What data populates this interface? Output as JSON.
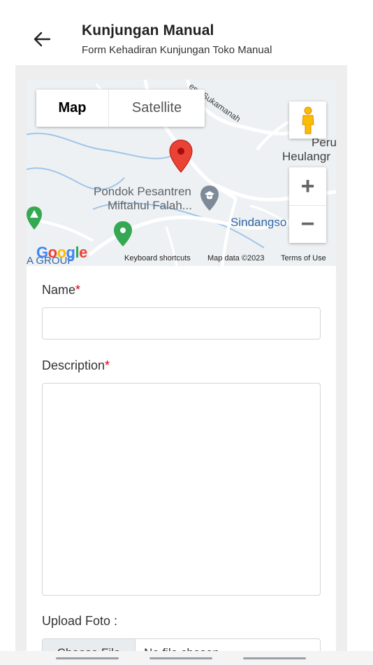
{
  "header": {
    "title": "Kunjungan Manual",
    "subtitle": "Form Kehadiran Kunjungan Toko Manual"
  },
  "map": {
    "type_map": "Map",
    "type_satellite": "Satellite",
    "zoom_in": "+",
    "zoom_out": "−",
    "places": {
      "road": "esa Sukamanah",
      "peru": "Peru",
      "heulang": "Heulangr",
      "pondok_line1": "Pondok Pesantren",
      "pondok_line2": "Miftahul Falah...",
      "sindang": "Sindangso",
      "agroup": "A GROUP"
    },
    "logo": "Google",
    "attribution": {
      "shortcuts": "Keyboard shortcuts",
      "data": "Map data ©2023",
      "terms": "Terms of Use"
    }
  },
  "form": {
    "name_label": "Name",
    "description_label": "Description",
    "required_mark": "*",
    "upload_label": "Upload Foto :",
    "name_value": "",
    "description_value": "",
    "choose_file": "Choose File",
    "no_file": "No file chosen"
  },
  "colors": {
    "required": "#d0021b",
    "marker": "#ea4335",
    "poi_green": "#34a853",
    "poi_gray": "#7d8b99"
  }
}
